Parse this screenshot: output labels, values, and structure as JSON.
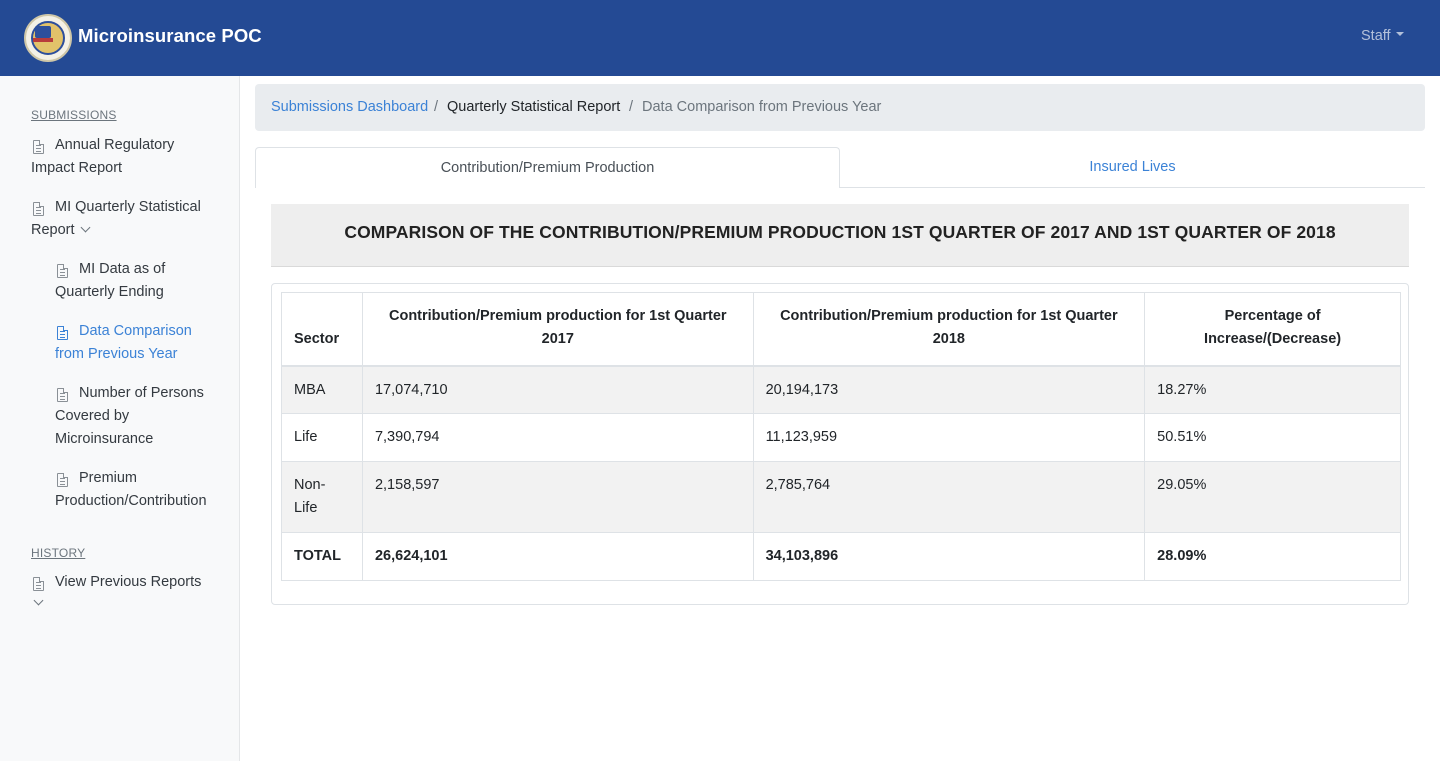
{
  "app": {
    "brand": "Microinsurance POC",
    "user_menu": "Staff"
  },
  "sidebar": {
    "sections": [
      {
        "heading": "SUBMISSIONS",
        "items": [
          {
            "label": "Annual Regulatory Impact Report",
            "lines": [
              "Annual Regulatory",
              "Impact Report"
            ]
          },
          {
            "label": "MI Quarterly Statistical Report",
            "lines": [
              "MI Quarterly Statistical",
              "Report"
            ],
            "expanded": true,
            "children": [
              {
                "lines": [
                  "MI Data as of",
                  "Quarterly Ending"
                ]
              },
              {
                "lines": [
                  "Data Comparison",
                  "from Previous Year"
                ],
                "active": true
              },
              {
                "lines": [
                  "Number of Persons",
                  "Covered by",
                  "Microinsurance"
                ]
              },
              {
                "lines": [
                  "Premium",
                  "Production/Contribution"
                ]
              }
            ]
          }
        ]
      },
      {
        "heading": "HISTORY",
        "items": [
          {
            "lines": [
              "View Previous Reports"
            ]
          }
        ]
      }
    ]
  },
  "breadcrumb": [
    "Submissions Dashboard",
    "Quarterly Statistical Report",
    "Data Comparison from Previous Year"
  ],
  "tabs": [
    "Contribution/Premium Production",
    "Insured Lives"
  ],
  "report": {
    "title": "COMPARISON OF THE CONTRIBUTION/PREMIUM PRODUCTION 1ST QUARTER OF 2017 AND 1ST QUARTER OF 2018",
    "columns": [
      {
        "lines": [
          "Sector"
        ]
      },
      {
        "lines": [
          "Contribution/Premium production for 1st Quarter",
          "2017"
        ]
      },
      {
        "lines": [
          "Contribution/Premium production for 1st Quarter",
          "2018"
        ]
      },
      {
        "lines": [
          "Percentage of",
          "Increase/(Decrease)"
        ]
      }
    ],
    "rows": [
      {
        "sector": "MBA",
        "q2017": "17,074,710",
        "q2018": "20,194,173",
        "pct": "18.27%"
      },
      {
        "sector": "Life",
        "q2017": "7,390,794",
        "q2018": "11,123,959",
        "pct": "50.51%"
      },
      {
        "sector": "Non-Life",
        "sector_lines": [
          "Non-",
          "Life"
        ],
        "q2017": "2,158,597",
        "q2018": "2,785,764",
        "pct": "29.05%"
      }
    ],
    "total": {
      "sector": "TOTAL",
      "q2017": "26,624,101",
      "q2018": "34,103,896",
      "pct": "28.09%"
    }
  }
}
